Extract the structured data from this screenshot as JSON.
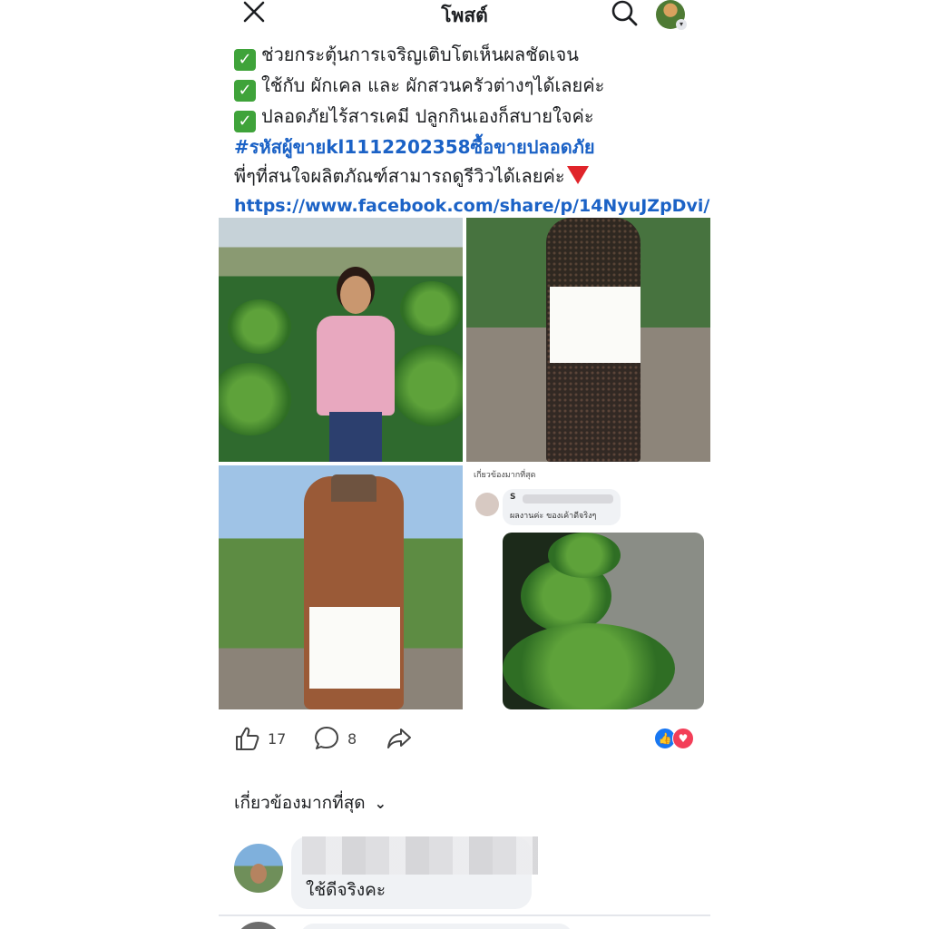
{
  "header": {
    "title": "โพสต์",
    "close_icon": "close-icon",
    "search_icon": "search-icon"
  },
  "post": {
    "lines": [
      "ช่วยกระตุ้นการเจริญเติบโตเห็นผลชัดเจน",
      "ใช้กับ ผักเคล และ ผักสวนครัวต่างๆได้เลยค่ะ",
      "ปลอดภัยไร้สารเคมี ปลูกกินเองก็สบายใจค่ะ"
    ],
    "hashtag": "#รหัสผู้ขายkl1112202358ซื้อขายปลอดภัย",
    "cta": "พี่ๆที่สนใจผลิตภัณฑ์สามารถดูรีวิวได้เลยค่ะ",
    "url": "https://www.facebook.com/share/p/14NyuJZpDvi/"
  },
  "photos": {
    "comment_screenshot": {
      "sort_label": "เกี่ยวข้องมากที่สุด",
      "commenter_initial": "S",
      "comment_text": "ผลงานค่ะ ของเค้าดีจริงๆ"
    }
  },
  "actions": {
    "likes": "17",
    "comments": "8"
  },
  "comments_section": {
    "sort_label": "เกี่ยวข้องมากที่สุด",
    "first_comment_text": "ใช้ดีจริงคะ"
  },
  "colors": {
    "link": "#1b62c6",
    "check": "#3fa33a",
    "like": "#1877f2",
    "love": "#f33e58"
  }
}
